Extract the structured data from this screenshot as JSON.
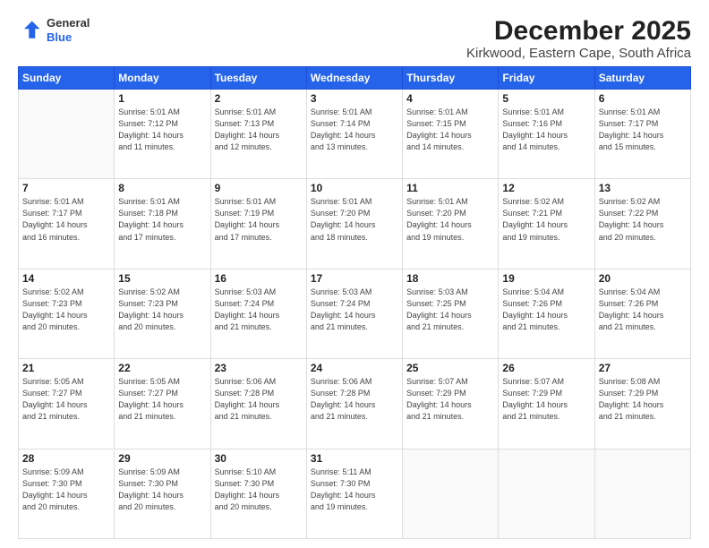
{
  "logo": {
    "general": "General",
    "blue": "Blue"
  },
  "title": "December 2025",
  "subtitle": "Kirkwood, Eastern Cape, South Africa",
  "days_of_week": [
    "Sunday",
    "Monday",
    "Tuesday",
    "Wednesday",
    "Thursday",
    "Friday",
    "Saturday"
  ],
  "weeks": [
    [
      {
        "day": "",
        "info": ""
      },
      {
        "day": "1",
        "info": "Sunrise: 5:01 AM\nSunset: 7:12 PM\nDaylight: 14 hours\nand 11 minutes."
      },
      {
        "day": "2",
        "info": "Sunrise: 5:01 AM\nSunset: 7:13 PM\nDaylight: 14 hours\nand 12 minutes."
      },
      {
        "day": "3",
        "info": "Sunrise: 5:01 AM\nSunset: 7:14 PM\nDaylight: 14 hours\nand 13 minutes."
      },
      {
        "day": "4",
        "info": "Sunrise: 5:01 AM\nSunset: 7:15 PM\nDaylight: 14 hours\nand 14 minutes."
      },
      {
        "day": "5",
        "info": "Sunrise: 5:01 AM\nSunset: 7:16 PM\nDaylight: 14 hours\nand 14 minutes."
      },
      {
        "day": "6",
        "info": "Sunrise: 5:01 AM\nSunset: 7:17 PM\nDaylight: 14 hours\nand 15 minutes."
      }
    ],
    [
      {
        "day": "7",
        "info": "Sunrise: 5:01 AM\nSunset: 7:17 PM\nDaylight: 14 hours\nand 16 minutes."
      },
      {
        "day": "8",
        "info": "Sunrise: 5:01 AM\nSunset: 7:18 PM\nDaylight: 14 hours\nand 17 minutes."
      },
      {
        "day": "9",
        "info": "Sunrise: 5:01 AM\nSunset: 7:19 PM\nDaylight: 14 hours\nand 17 minutes."
      },
      {
        "day": "10",
        "info": "Sunrise: 5:01 AM\nSunset: 7:20 PM\nDaylight: 14 hours\nand 18 minutes."
      },
      {
        "day": "11",
        "info": "Sunrise: 5:01 AM\nSunset: 7:20 PM\nDaylight: 14 hours\nand 19 minutes."
      },
      {
        "day": "12",
        "info": "Sunrise: 5:02 AM\nSunset: 7:21 PM\nDaylight: 14 hours\nand 19 minutes."
      },
      {
        "day": "13",
        "info": "Sunrise: 5:02 AM\nSunset: 7:22 PM\nDaylight: 14 hours\nand 20 minutes."
      }
    ],
    [
      {
        "day": "14",
        "info": "Sunrise: 5:02 AM\nSunset: 7:23 PM\nDaylight: 14 hours\nand 20 minutes."
      },
      {
        "day": "15",
        "info": "Sunrise: 5:02 AM\nSunset: 7:23 PM\nDaylight: 14 hours\nand 20 minutes."
      },
      {
        "day": "16",
        "info": "Sunrise: 5:03 AM\nSunset: 7:24 PM\nDaylight: 14 hours\nand 21 minutes."
      },
      {
        "day": "17",
        "info": "Sunrise: 5:03 AM\nSunset: 7:24 PM\nDaylight: 14 hours\nand 21 minutes."
      },
      {
        "day": "18",
        "info": "Sunrise: 5:03 AM\nSunset: 7:25 PM\nDaylight: 14 hours\nand 21 minutes."
      },
      {
        "day": "19",
        "info": "Sunrise: 5:04 AM\nSunset: 7:26 PM\nDaylight: 14 hours\nand 21 minutes."
      },
      {
        "day": "20",
        "info": "Sunrise: 5:04 AM\nSunset: 7:26 PM\nDaylight: 14 hours\nand 21 minutes."
      }
    ],
    [
      {
        "day": "21",
        "info": "Sunrise: 5:05 AM\nSunset: 7:27 PM\nDaylight: 14 hours\nand 21 minutes."
      },
      {
        "day": "22",
        "info": "Sunrise: 5:05 AM\nSunset: 7:27 PM\nDaylight: 14 hours\nand 21 minutes."
      },
      {
        "day": "23",
        "info": "Sunrise: 5:06 AM\nSunset: 7:28 PM\nDaylight: 14 hours\nand 21 minutes."
      },
      {
        "day": "24",
        "info": "Sunrise: 5:06 AM\nSunset: 7:28 PM\nDaylight: 14 hours\nand 21 minutes."
      },
      {
        "day": "25",
        "info": "Sunrise: 5:07 AM\nSunset: 7:29 PM\nDaylight: 14 hours\nand 21 minutes."
      },
      {
        "day": "26",
        "info": "Sunrise: 5:07 AM\nSunset: 7:29 PM\nDaylight: 14 hours\nand 21 minutes."
      },
      {
        "day": "27",
        "info": "Sunrise: 5:08 AM\nSunset: 7:29 PM\nDaylight: 14 hours\nand 21 minutes."
      }
    ],
    [
      {
        "day": "28",
        "info": "Sunrise: 5:09 AM\nSunset: 7:30 PM\nDaylight: 14 hours\nand 20 minutes."
      },
      {
        "day": "29",
        "info": "Sunrise: 5:09 AM\nSunset: 7:30 PM\nDaylight: 14 hours\nand 20 minutes."
      },
      {
        "day": "30",
        "info": "Sunrise: 5:10 AM\nSunset: 7:30 PM\nDaylight: 14 hours\nand 20 minutes."
      },
      {
        "day": "31",
        "info": "Sunrise: 5:11 AM\nSunset: 7:30 PM\nDaylight: 14 hours\nand 19 minutes."
      },
      {
        "day": "",
        "info": ""
      },
      {
        "day": "",
        "info": ""
      },
      {
        "day": "",
        "info": ""
      }
    ]
  ]
}
